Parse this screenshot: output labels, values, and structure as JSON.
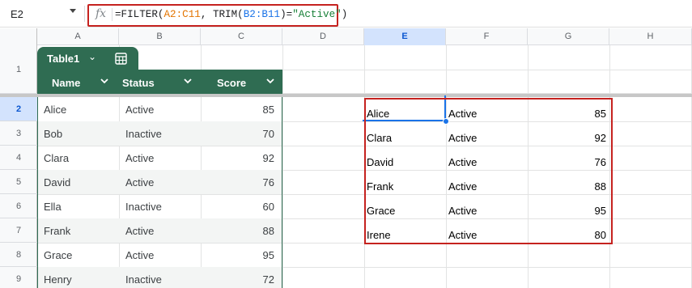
{
  "name_box": {
    "value": "E2"
  },
  "formula_bar": {
    "fx": "fx",
    "parts": [
      {
        "text": "=FILTER(",
        "kind": "plain"
      },
      {
        "text": "A2:C11",
        "kind": "range1"
      },
      {
        "text": ", TRIM(",
        "kind": "plain"
      },
      {
        "text": "B2:B11",
        "kind": "range2"
      },
      {
        "text": ")=",
        "kind": "plain"
      },
      {
        "text": "\"Active\"",
        "kind": "str"
      },
      {
        "text": ")",
        "kind": "plain"
      }
    ]
  },
  "columns": [
    "A",
    "B",
    "C",
    "D",
    "E",
    "F",
    "G",
    "H"
  ],
  "selected_column": "E",
  "rows": [
    "1",
    "2",
    "3",
    "4",
    "5",
    "6",
    "7",
    "8",
    "9"
  ],
  "selected_row": "2",
  "table": {
    "name": "Table1",
    "headers": [
      "Name",
      "Status",
      "Score"
    ],
    "data": [
      [
        "Alice",
        "Active",
        "85"
      ],
      [
        "Bob",
        "Inactive",
        "70"
      ],
      [
        "Clara",
        "Active",
        "92"
      ],
      [
        "David",
        "Active",
        "76"
      ],
      [
        "Ella",
        "Inactive",
        "60"
      ],
      [
        "Frank",
        "Active",
        "88"
      ],
      [
        "Grace",
        "Active",
        "95"
      ],
      [
        "Henry",
        "Inactive",
        "72"
      ]
    ]
  },
  "result": [
    [
      "Alice",
      "Active",
      "85"
    ],
    [
      "Clara",
      "Active",
      "92"
    ],
    [
      "David",
      "Active",
      "76"
    ],
    [
      "Frank",
      "Active",
      "88"
    ],
    [
      "Grace",
      "Active",
      "95"
    ],
    [
      "Irene",
      "Active",
      "80"
    ]
  ],
  "colors": {
    "table_green": "#2f6c52",
    "highlight_red": "#c5221f",
    "selection_blue": "#1a73e8"
  }
}
